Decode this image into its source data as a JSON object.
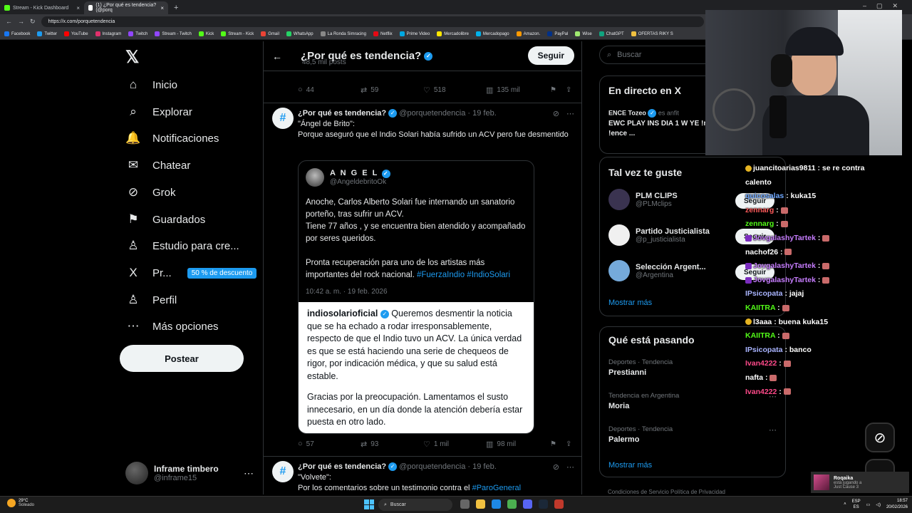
{
  "browser": {
    "tabs": [
      {
        "label": "Stream - Kick Dashboard",
        "color": "#53fc18"
      },
      {
        "label": "(1) ¿Por qué es tendencia? (@porq",
        "color": "#ffffff"
      }
    ],
    "new_tab": "+",
    "url": "https://x.com/porquetendencia",
    "bookmarks": [
      {
        "label": "Facebook",
        "color": "#1877f2"
      },
      {
        "label": "Twitter",
        "color": "#1d9bf0"
      },
      {
        "label": "YouTube",
        "color": "#ff0000"
      },
      {
        "label": "Instagram",
        "color": "#e1306c"
      },
      {
        "label": "Twitch",
        "color": "#9146ff"
      },
      {
        "label": "Stream - Twitch",
        "color": "#9146ff"
      },
      {
        "label": "Kick",
        "color": "#53fc18"
      },
      {
        "label": "Stream - Kick",
        "color": "#53fc18"
      },
      {
        "label": "Gmail",
        "color": "#ea4335"
      },
      {
        "label": "WhatsApp",
        "color": "#25d366"
      },
      {
        "label": "La Ronda Simracing",
        "color": "#888888"
      },
      {
        "label": "Netflix",
        "color": "#e50914"
      },
      {
        "label": "Prime Video",
        "color": "#00a8e1"
      },
      {
        "label": "Mercadolibre",
        "color": "#ffe600"
      },
      {
        "label": "Mercadopago",
        "color": "#00b1ea"
      },
      {
        "label": "Amazon.",
        "color": "#ff9900"
      },
      {
        "label": "PayPal",
        "color": "#003087"
      },
      {
        "label": "Wise",
        "color": "#9fe870"
      },
      {
        "label": "ChatGPT",
        "color": "#10a37f"
      },
      {
        "label": "OFERTAS RIKY S",
        "color": "#f0c040"
      }
    ]
  },
  "nav": {
    "items": [
      {
        "label": "Inicio",
        "icon": "⌂",
        "name": "home"
      },
      {
        "label": "Explorar",
        "icon": "⌕",
        "name": "explore"
      },
      {
        "label": "Notificaciones",
        "icon": "🔔",
        "name": "notifications"
      },
      {
        "label": "Chatear",
        "icon": "✉",
        "name": "chat"
      },
      {
        "label": "Grok",
        "icon": "⊘",
        "name": "grok"
      },
      {
        "label": "Guardados",
        "icon": "⚑",
        "name": "bookmarks"
      },
      {
        "label": "Estudio para cre...",
        "icon": "♙",
        "name": "creator-studio"
      },
      {
        "label": "Pr...",
        "icon": "X",
        "name": "premium"
      },
      {
        "label": "Perfil",
        "icon": "♙",
        "name": "profile"
      },
      {
        "label": "Más opciones",
        "icon": "⋯",
        "name": "more"
      }
    ],
    "notif_count": "1",
    "premium_badge": "50 % de descuento",
    "post_button": "Postear",
    "user": {
      "name": "Inframe timbero",
      "handle": "@inframe15"
    }
  },
  "header": {
    "title": "¿Por qué es tendencia?",
    "posts_count": "48,5 mil posts",
    "follow": "Seguir"
  },
  "top_actions": {
    "replies": "44",
    "reposts": "59",
    "likes": "518",
    "views": "135 mil"
  },
  "tweet1": {
    "author": "¿Por qué es tendencia?",
    "handle": "@porquetendencia",
    "date": "· 19 feb.",
    "line1": "\"Ángel de Brito\":",
    "line2": "Porque aseguró que el Indio Solari había sufrido un ACV pero fue desmentido",
    "quote": {
      "name": "A N G E L",
      "handle": "@AngeldebritoOk",
      "p1": "Anoche, Carlos Alberto Solari fue internando un sanatorio porteño, tras sufrir un ACV.",
      "p2": "Tiene 77 años , y se encuentra bien atendido y acompañado por seres queridos.",
      "p3": "Pronta recuperación para uno de los artistas más importantes del rock nacional.",
      "hashtags": "#FuerzaIndio #IndioSolari",
      "date": "10:42 a. m. · 19 feb. 2026",
      "img_user": "indiosolarioficial",
      "img_p1": "Queremos desmentir la noticia que se ha echado a rodar irresponsablemente, respecto de que el Indio tuvo un ACV. La única verdad es que se está haciendo una serie de chequeos de rigor, por indicación médica, y que su salud está estable.",
      "img_p2": "Gracias por la preocupación. Lamentamos el susto innecesario, en un día donde la atención debería estar puesta en otro lado."
    },
    "actions": {
      "replies": "57",
      "reposts": "93",
      "likes": "1 mil",
      "views": "98 mil"
    }
  },
  "tweet2": {
    "author": "¿Por qué es tendencia?",
    "handle": "@porquetendencia",
    "date": "· 19 feb.",
    "line1": "\"Volvete\":",
    "line2": "Por los comentarios sobre un testimonio contra el",
    "hashtag": "#ParoGeneral"
  },
  "right": {
    "search_placeholder": "Buscar",
    "live": {
      "title": "En directo en X",
      "host": "ENCE Tozeo",
      "host_suffix": "es anfit",
      "text": "EWC PLAY INS DIA 1 W YE !mapa !1v1 !code !ence ..."
    },
    "suggestions": {
      "title": "Tal vez te guste",
      "items": [
        {
          "name": "PLM CLIPS",
          "handle": "@PLMclips",
          "color": "#3a3350"
        },
        {
          "name": "Partido Justicialista",
          "handle": "@p_justicialista",
          "color": "#f0f0f0"
        },
        {
          "name": "Selección Argent...",
          "handle": "@Argentina",
          "color": "#75aadb"
        }
      ],
      "follow": "Seguir",
      "more": "Mostrar más"
    },
    "trends": {
      "title": "Qué está pasando",
      "items": [
        {
          "context": "Deportes · Tendencia",
          "name": "Prestianni"
        },
        {
          "context": "Tendencia en Argentina",
          "name": "Moria"
        },
        {
          "context": "Deportes · Tendencia",
          "name": "Palermo"
        }
      ],
      "more": "Mostrar más"
    },
    "footer": "Condiciones de Servicio    Política de Privacidad"
  },
  "chat": [
    {
      "user": "juancitoarias9811",
      "color": "#ffffff",
      "msg": " : se re contra",
      "badge": "gold"
    },
    {
      "user": "",
      "color": "#ffffff",
      "msg": "calento",
      "badge": ""
    },
    {
      "user": "quicosalas",
      "color": "#6fa8ff",
      "msg": " : kuka15",
      "badge": ""
    },
    {
      "user": "zennarg",
      "color": "#ff5a5a",
      "msg": " : ",
      "badge": "",
      "emote": true
    },
    {
      "user": "zennarg",
      "color": "#53fc18",
      "msg": " : ",
      "badge": "",
      "emote": true
    },
    {
      "user": "JovgalashyTartek",
      "color": "#c77dff",
      "msg": " : ",
      "badge": "purple",
      "emote": true
    },
    {
      "user": "nachof26",
      "color": "#ffffff",
      "msg": " : ",
      "badge": "",
      "emote": true
    },
    {
      "user": "JovgalashyTartek",
      "color": "#c77dff",
      "msg": " : ",
      "badge": "purple",
      "emote": true
    },
    {
      "user": "JovgalashyTartek",
      "color": "#c77dff",
      "msg": " : ",
      "badge": "purple",
      "emote": true
    },
    {
      "user": "IPsicopata",
      "color": "#a9b4ff",
      "msg": " : jajaj",
      "badge": ""
    },
    {
      "user": "KAIITRA",
      "color": "#53fc18",
      "msg": " : ",
      "badge": "",
      "emote": true
    },
    {
      "user": "l3aaa",
      "color": "#ffffff",
      "msg": " : buena kuka15",
      "badge": "gold"
    },
    {
      "user": "KAIITRA",
      "color": "#53fc18",
      "msg": " : ",
      "badge": "",
      "emote": true
    },
    {
      "user": "IPsicopata",
      "color": "#a9b4ff",
      "msg": " : banco",
      "badge": ""
    },
    {
      "user": "Ivan4222",
      "color": "#ff4a8a",
      "msg": " : ",
      "badge": "",
      "emote": true
    },
    {
      "user": "nafta",
      "color": "#ffffff",
      "msg": " : ",
      "badge": "",
      "emote": true
    },
    {
      "user": "Ivan4222",
      "color": "#ff4a8a",
      "msg": " : ",
      "badge": "",
      "emote": true
    }
  ],
  "toast": {
    "title": "Roqaika",
    "sub": "está jugando a",
    "game": "Just Cause 3"
  },
  "taskbar": {
    "weather_temp": "29°C",
    "weather_desc": "Soleado",
    "search": "Buscar",
    "lang1": "ESP",
    "lang2": "ES",
    "time": "18:57",
    "date": "20/02/2026"
  }
}
